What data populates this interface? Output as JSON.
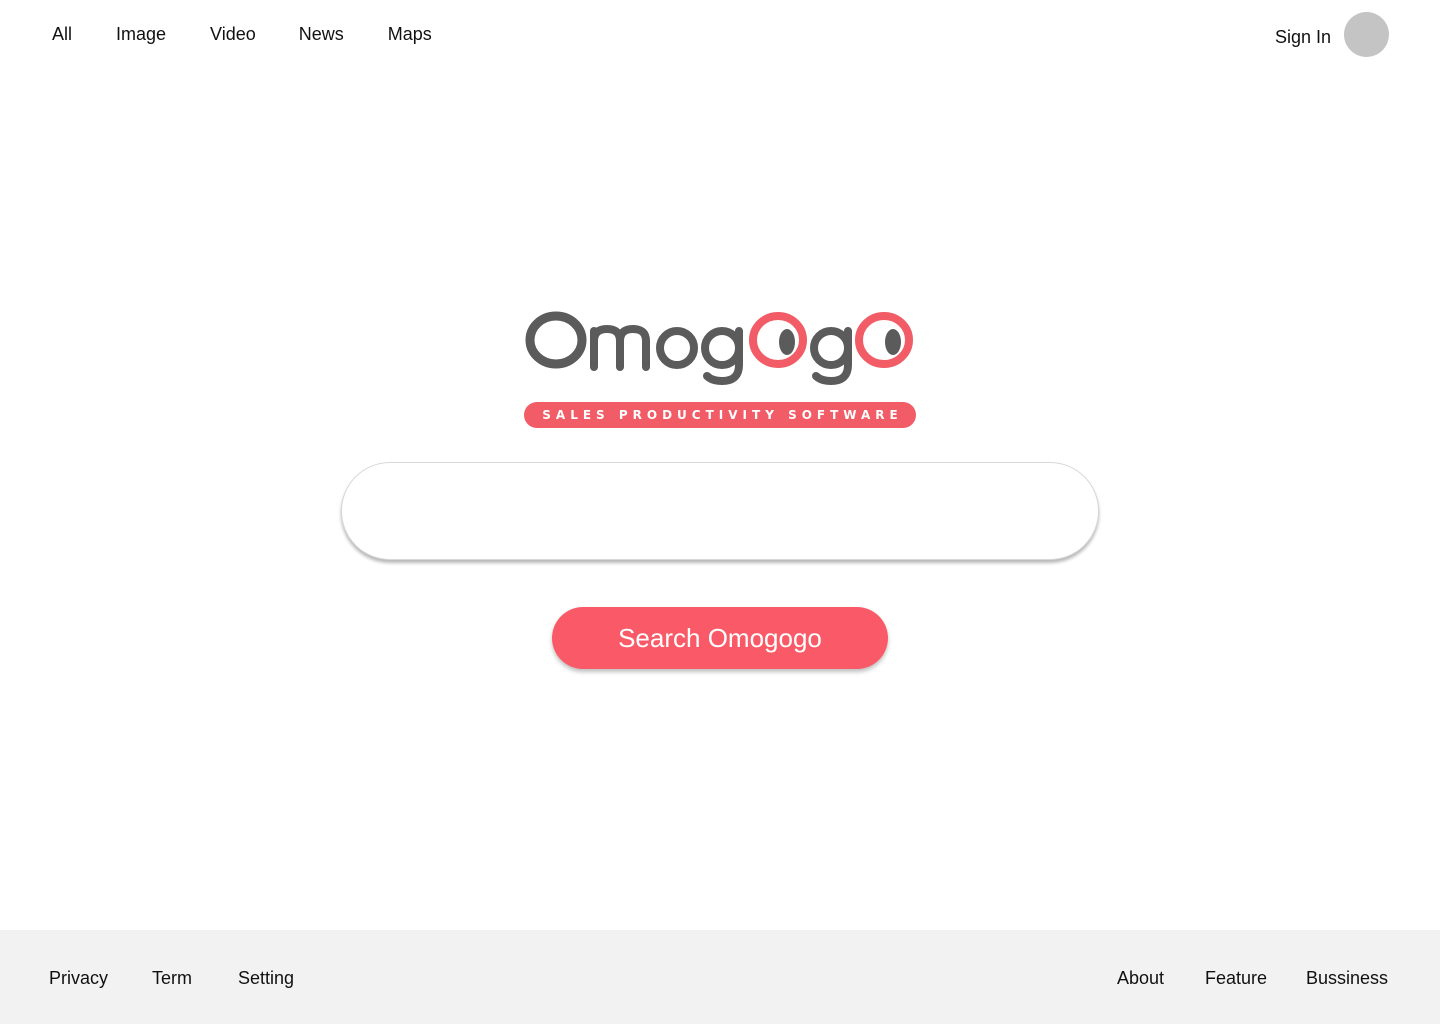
{
  "top_nav": {
    "items": [
      {
        "label": "All"
      },
      {
        "label": "Image"
      },
      {
        "label": "Video"
      },
      {
        "label": "News"
      },
      {
        "label": "Maps"
      }
    ]
  },
  "header": {
    "sign_in_label": "Sign In"
  },
  "logo": {
    "wordmark": "OmogOgO",
    "tagline": "SALES PRODUCTIVITY SOFTWARE",
    "colors": {
      "grey": "#5b5b5b",
      "red": "#f25c66"
    }
  },
  "search": {
    "value": "",
    "placeholder": "",
    "button_label": "Search Omogogo"
  },
  "footer": {
    "left_links": [
      {
        "label": "Privacy"
      },
      {
        "label": "Term"
      },
      {
        "label": "Setting"
      }
    ],
    "right_links": [
      {
        "label": "About"
      },
      {
        "label": "Feature"
      },
      {
        "label": "Bussiness"
      }
    ]
  },
  "colors": {
    "accent": "#fa5a67",
    "avatar": "#c4c4c4",
    "footer_bg": "#f2f2f2"
  }
}
